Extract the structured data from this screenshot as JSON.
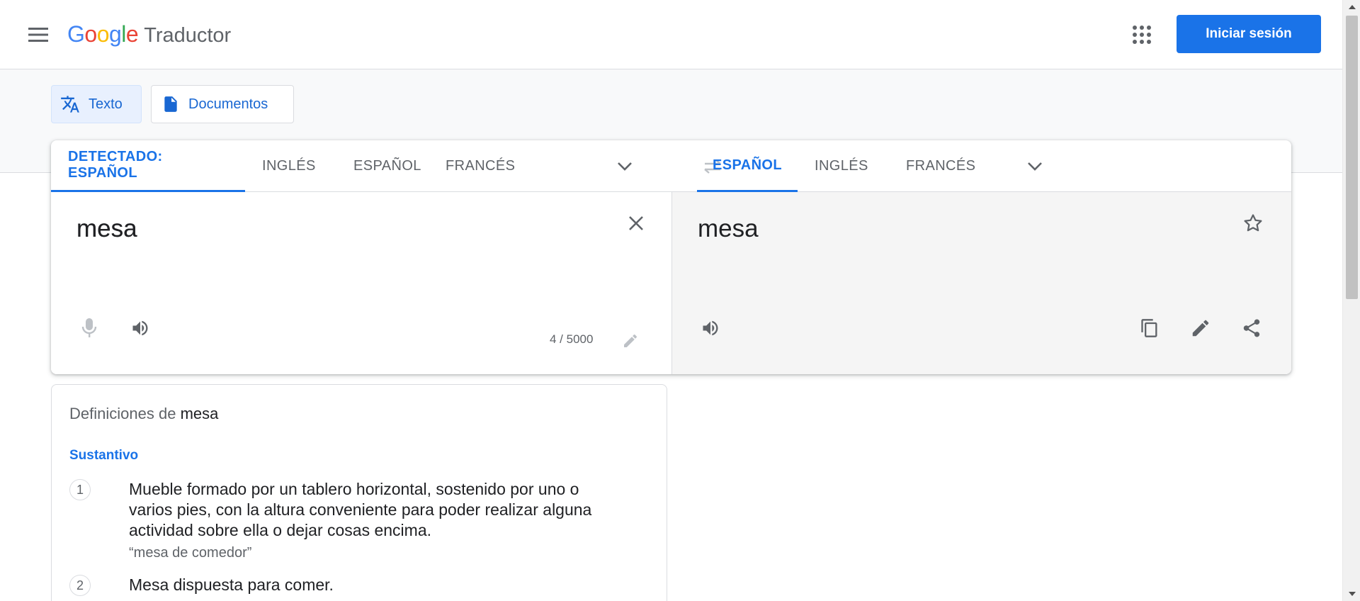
{
  "header": {
    "logo_google": [
      "G",
      "o",
      "o",
      "g",
      "l",
      "e"
    ],
    "logo_colors": [
      "#4285F4",
      "#EA4335",
      "#FBBC05",
      "#4285F4",
      "#34A853",
      "#EA4335"
    ],
    "product": "Traductor",
    "signin_label": "Iniciar sesión",
    "menu_icon": "hamburger-menu-icon",
    "apps_icon": "apps-grid-icon"
  },
  "modes": [
    {
      "label": "Texto",
      "icon": "translate-icon",
      "active": true
    },
    {
      "label": "Documentos",
      "icon": "document-icon",
      "active": false
    }
  ],
  "source_languages": [
    {
      "label": "DETECTADO: ESPAÑOL",
      "active": true
    },
    {
      "label": "INGLÉS",
      "active": false
    },
    {
      "label": "ESPAÑOL",
      "active": false
    },
    {
      "label": "FRANCÉS",
      "active": false
    }
  ],
  "target_languages": [
    {
      "label": "ESPAÑOL",
      "active": true
    },
    {
      "label": "INGLÉS",
      "active": false
    },
    {
      "label": "FRANCÉS",
      "active": false
    }
  ],
  "source": {
    "text": "mesa",
    "char_count": "4 / 5000"
  },
  "target": {
    "text": "mesa"
  },
  "definitions": {
    "title_prefix": "Definiciones de",
    "word": "mesa",
    "part_of_speech": "Sustantivo",
    "items": [
      {
        "number": "1",
        "text": "Mueble formado por un tablero horizontal, sostenido por uno o varios pies, con la altura conveniente para poder realizar alguna actividad sobre ella o dejar cosas encima.",
        "example": "“mesa de comedor”"
      },
      {
        "number": "2",
        "text": "Mesa dispuesta para comer.",
        "example": ""
      }
    ]
  },
  "colors": {
    "accent": "#1a73e8",
    "target_bg": "#f5f5f5",
    "band_bg": "#f8f9fa"
  }
}
